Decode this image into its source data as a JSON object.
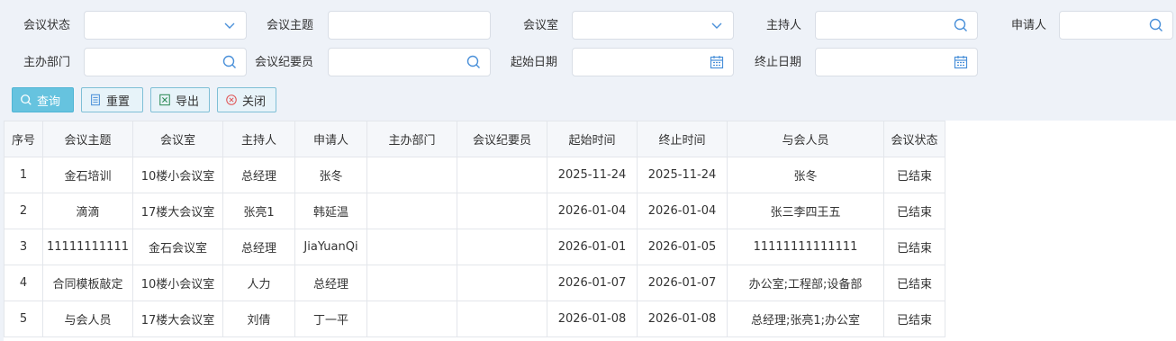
{
  "filters": {
    "status_label": "会议状态",
    "topic_label": "会议主题",
    "room_label": "会议室",
    "host_label": "主持人",
    "applicant_label": "申请人",
    "dept_label": "主办部门",
    "recorder_label": "会议纪要员",
    "start_label": "起始日期",
    "end_label": "终止日期"
  },
  "toolbar": {
    "query": "查询",
    "reset": "重置",
    "export": "导出",
    "close": "关闭"
  },
  "table": {
    "headers": [
      "序号",
      "会议主题",
      "会议室",
      "主持人",
      "申请人",
      "主办部门",
      "会议纪要员",
      "起始时间",
      "终止时间",
      "与会人员",
      "会议状态"
    ],
    "rows": [
      [
        "1",
        "金石培训",
        "10楼小会议室",
        "总经理",
        "张冬",
        "",
        "",
        "2025-11-24",
        "2025-11-24",
        "张冬",
        "已结束"
      ],
      [
        "2",
        "滴滴",
        "17楼大会议室",
        "张亮1",
        "韩延温",
        "",
        "",
        "2026-01-04",
        "2026-01-04",
        "张三李四王五",
        "已结束"
      ],
      [
        "3",
        "11111111111",
        "金石会议室",
        "总经理",
        "JiaYuanQi",
        "",
        "",
        "2026-01-01",
        "2026-01-05",
        "11111111111111",
        "已结束"
      ],
      [
        "4",
        "合同模板敲定",
        "10楼小会议室",
        "人力",
        "总经理",
        "",
        "",
        "2026-01-07",
        "2026-01-07",
        "办公室;工程部;设备部",
        "已结束"
      ],
      [
        "5",
        "与会人员",
        "17楼大会议室",
        "刘倩",
        "丁一平",
        "",
        "",
        "2026-01-08",
        "2026-01-08",
        "总经理;张亮1;办公室",
        "已结束"
      ]
    ]
  }
}
